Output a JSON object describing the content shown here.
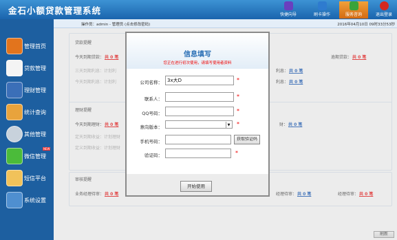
{
  "app": {
    "title": "金石小额贷款管理系统"
  },
  "top_buttons": [
    {
      "label": "快捷向导",
      "color": "#6a3fbf"
    },
    {
      "label": "刷卡操作",
      "color": "#2e7bcf"
    },
    {
      "label": "服务咨询",
      "color": "#3aa33a"
    },
    {
      "label": "退出登录",
      "color": "#d4281f"
    }
  ],
  "sidebar": {
    "items": [
      {
        "label": "管理首页",
        "icon": "home-icon",
        "color": "#e2741d"
      },
      {
        "label": "贷款管理",
        "icon": "notepad-icon",
        "color": "#f4f4f4"
      },
      {
        "label": "理财管理",
        "icon": "document-pen-icon",
        "color": "#3b6fb8"
      },
      {
        "label": "统计查询",
        "icon": "pie-chart-icon",
        "color": "#e8a33c"
      },
      {
        "label": "其他管理",
        "icon": "chrome-circle-icon",
        "color": "#c8d2dc"
      },
      {
        "label": "微信管理",
        "icon": "wechat-icon",
        "color": "#4bbb3a",
        "badge": "NEW"
      },
      {
        "label": "短信平台",
        "icon": "envelope-icon",
        "color": "#f1c25a"
      },
      {
        "label": "系统设置",
        "icon": "tools-icon",
        "color": "#4f8fd0"
      }
    ]
  },
  "infobar": {
    "user": "操作员：admin - 管理员   (点击修改密码)",
    "date": "2016年04月10日   09时33分53秒"
  },
  "loan_panel": {
    "title": "贷款提醒",
    "today_label": "今天到期贷款：",
    "today_value": "共 0 笔",
    "overdue_label": "逾期贷款：",
    "overdue_value": "共 0 笔",
    "three_day": "三天到期利息：计划利",
    "three_day_mid": "利息：",
    "three_day_value": "共 0 笔",
    "today_interest": "今天到期利息：计划利",
    "today_interest_mid": "利息：",
    "today_interest_value": "共 0 笔"
  },
  "finance_panel": {
    "title": "理财提醒",
    "today_label": "今天到期理财：",
    "today_value": "共 0 笔",
    "mid_label": "财：",
    "mid_value": "共 0 笔",
    "fixed_today": "定天到期收益：计划理财",
    "fixed_three": "定义到期收益：计划理财"
  },
  "review_panel": {
    "title": "审核提醒",
    "rate_label": "业务经理待审：",
    "rate_value": "共 0 笔",
    "mid_label": "经理待审：",
    "mid_value": "共 0 笔",
    "right_label": "经理待审：",
    "right_value": "共 0 笔"
  },
  "refresh_label": "刷新",
  "modal": {
    "title": "信息填写",
    "note": "您正在进行初次使用，请填写使用者资料",
    "fields": {
      "company_label": "公司名称：",
      "company_value": "3x大D",
      "contact_label": "联系人：",
      "contact_value": "",
      "qq_label": "QQ号码：",
      "qq_value": "",
      "version_label": "意向版本：",
      "version_value": "",
      "phone_label": "手机号码：",
      "phone_value": "",
      "code_label": "验证码：",
      "code_value": ""
    },
    "get_code_label": "获取验证码",
    "start_label": "开始使用"
  }
}
